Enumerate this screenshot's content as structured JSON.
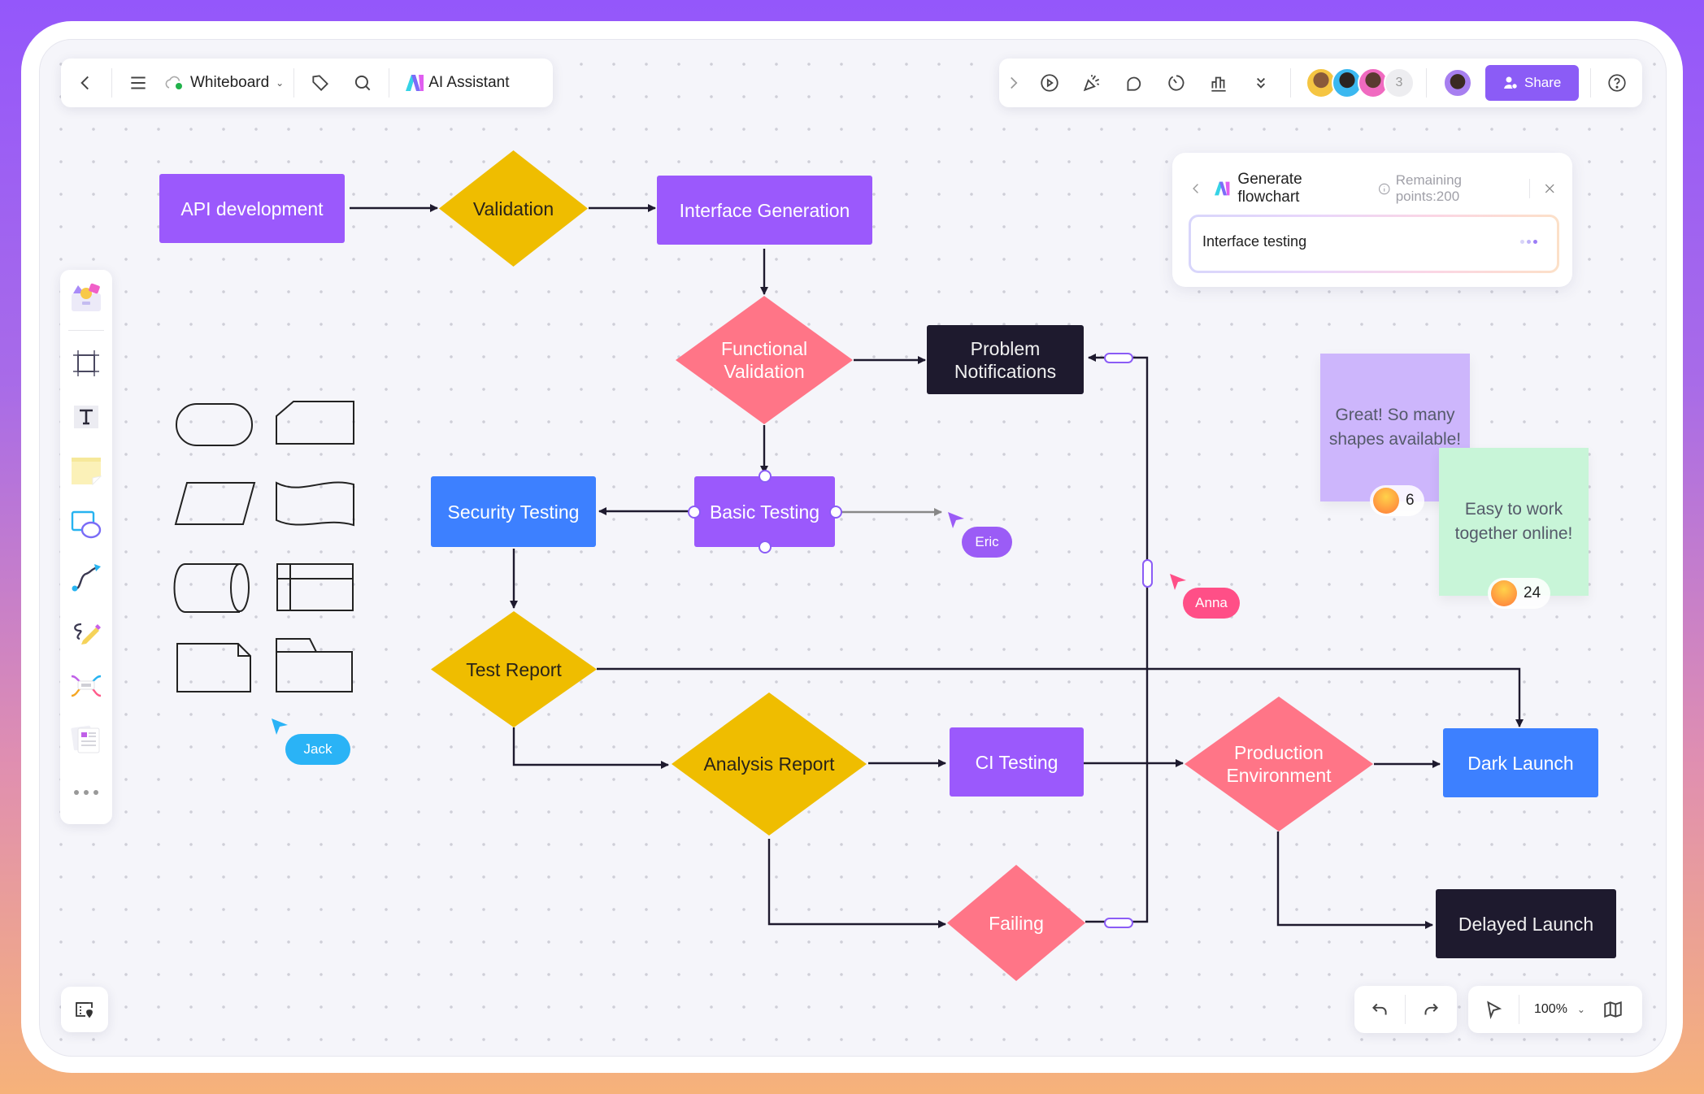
{
  "app": {
    "name": "Whiteboard"
  },
  "toolbar_left": {
    "back_icon": "chevron-left-icon",
    "menu_icon": "hamburger-menu-icon",
    "cloud_status": "synced",
    "title": "Whiteboard",
    "tag_icon": "tag-icon",
    "search_icon": "search-icon",
    "ai_label": "AI Assistant"
  },
  "toolbar_right": {
    "expand_icon": "chevron-right-icon",
    "tools": [
      "play-icon",
      "celebrate-icon",
      "comment-icon",
      "timer-icon",
      "vote-chart-icon",
      "more-chevrons-icon"
    ],
    "collaborators_extra_count": "3",
    "share_label": "Share",
    "help_icon": "help-icon"
  },
  "ai_panel": {
    "title": "Generate flowchart",
    "remaining": "Remaining points:200",
    "input_value": "Interface testing"
  },
  "left_toolbar": {
    "tools": [
      "templates",
      "frame",
      "text",
      "sticky-note",
      "shapes",
      "connector",
      "pen",
      "mindmap",
      "document",
      "more"
    ]
  },
  "flowchart": {
    "nodes": {
      "api": "API development",
      "validation": "Validation",
      "interface_gen": "Interface Generation",
      "functional_validation": "Functional Validation",
      "problem_notifications": "Problem Notifications",
      "basic_testing": "Basic Testing",
      "security_testing": "Security Testing",
      "test_report": "Test Report",
      "analysis_report": "Analysis Report",
      "ci_testing": "CI Testing",
      "production_env": "Production Environment",
      "dark_launch": "Dark Launch",
      "delayed_launch": "Delayed Launch",
      "failing": "Failing"
    },
    "colors": {
      "purple": "#9b59fc",
      "yellow": "#efbd00",
      "pink": "#ff7587",
      "blue": "#3d80ff",
      "dark": "#1e1a2e"
    }
  },
  "sticky_notes": [
    {
      "text": "Great! So many shapes available!",
      "color": "#cdb6fc",
      "reaction_count": "6"
    },
    {
      "text": "Easy to work together online!",
      "color": "#c8f5d8",
      "reaction_count": "24"
    }
  ],
  "cursors": [
    {
      "name": "Jack",
      "color": "#2ab3f6"
    },
    {
      "name": "Eric",
      "color": "#9b5cf6"
    },
    {
      "name": "Anna",
      "color": "#ff4f87"
    }
  ],
  "bottom_bar": {
    "zoom": "100%"
  }
}
